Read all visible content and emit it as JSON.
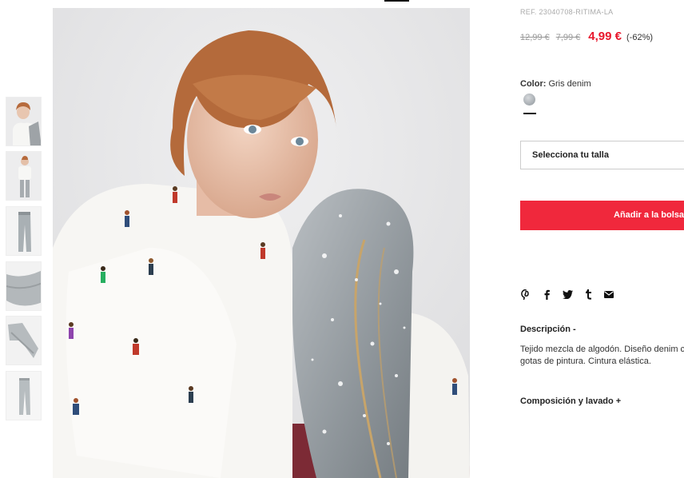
{
  "product": {
    "ref": "REF. 23040708-RITIMA-LA",
    "price_original": "12,99 €",
    "price_previous": "7,99 €",
    "price_current": "4,99 €",
    "discount": "(-62%)",
    "color_label": "Color:",
    "color_value": "Gris denim",
    "size_placeholder": "Selecciona tu talla",
    "add_to_bag": "Añadir a la bolsa"
  },
  "share_icons": [
    "pinterest-icon",
    "facebook-icon",
    "twitter-icon",
    "tumblr-icon",
    "mail-icon"
  ],
  "description": {
    "title": "Descripción -",
    "text": "Tejido mezcla de algodón. Diseño denim con gotas de pintura. Cintura elástica."
  },
  "composition": {
    "title": "Composición y lavado +"
  },
  "gallery": {
    "thumbnail_count": 6
  },
  "colors": {
    "accent": "#f0283c",
    "price_red": "#e8172c"
  }
}
